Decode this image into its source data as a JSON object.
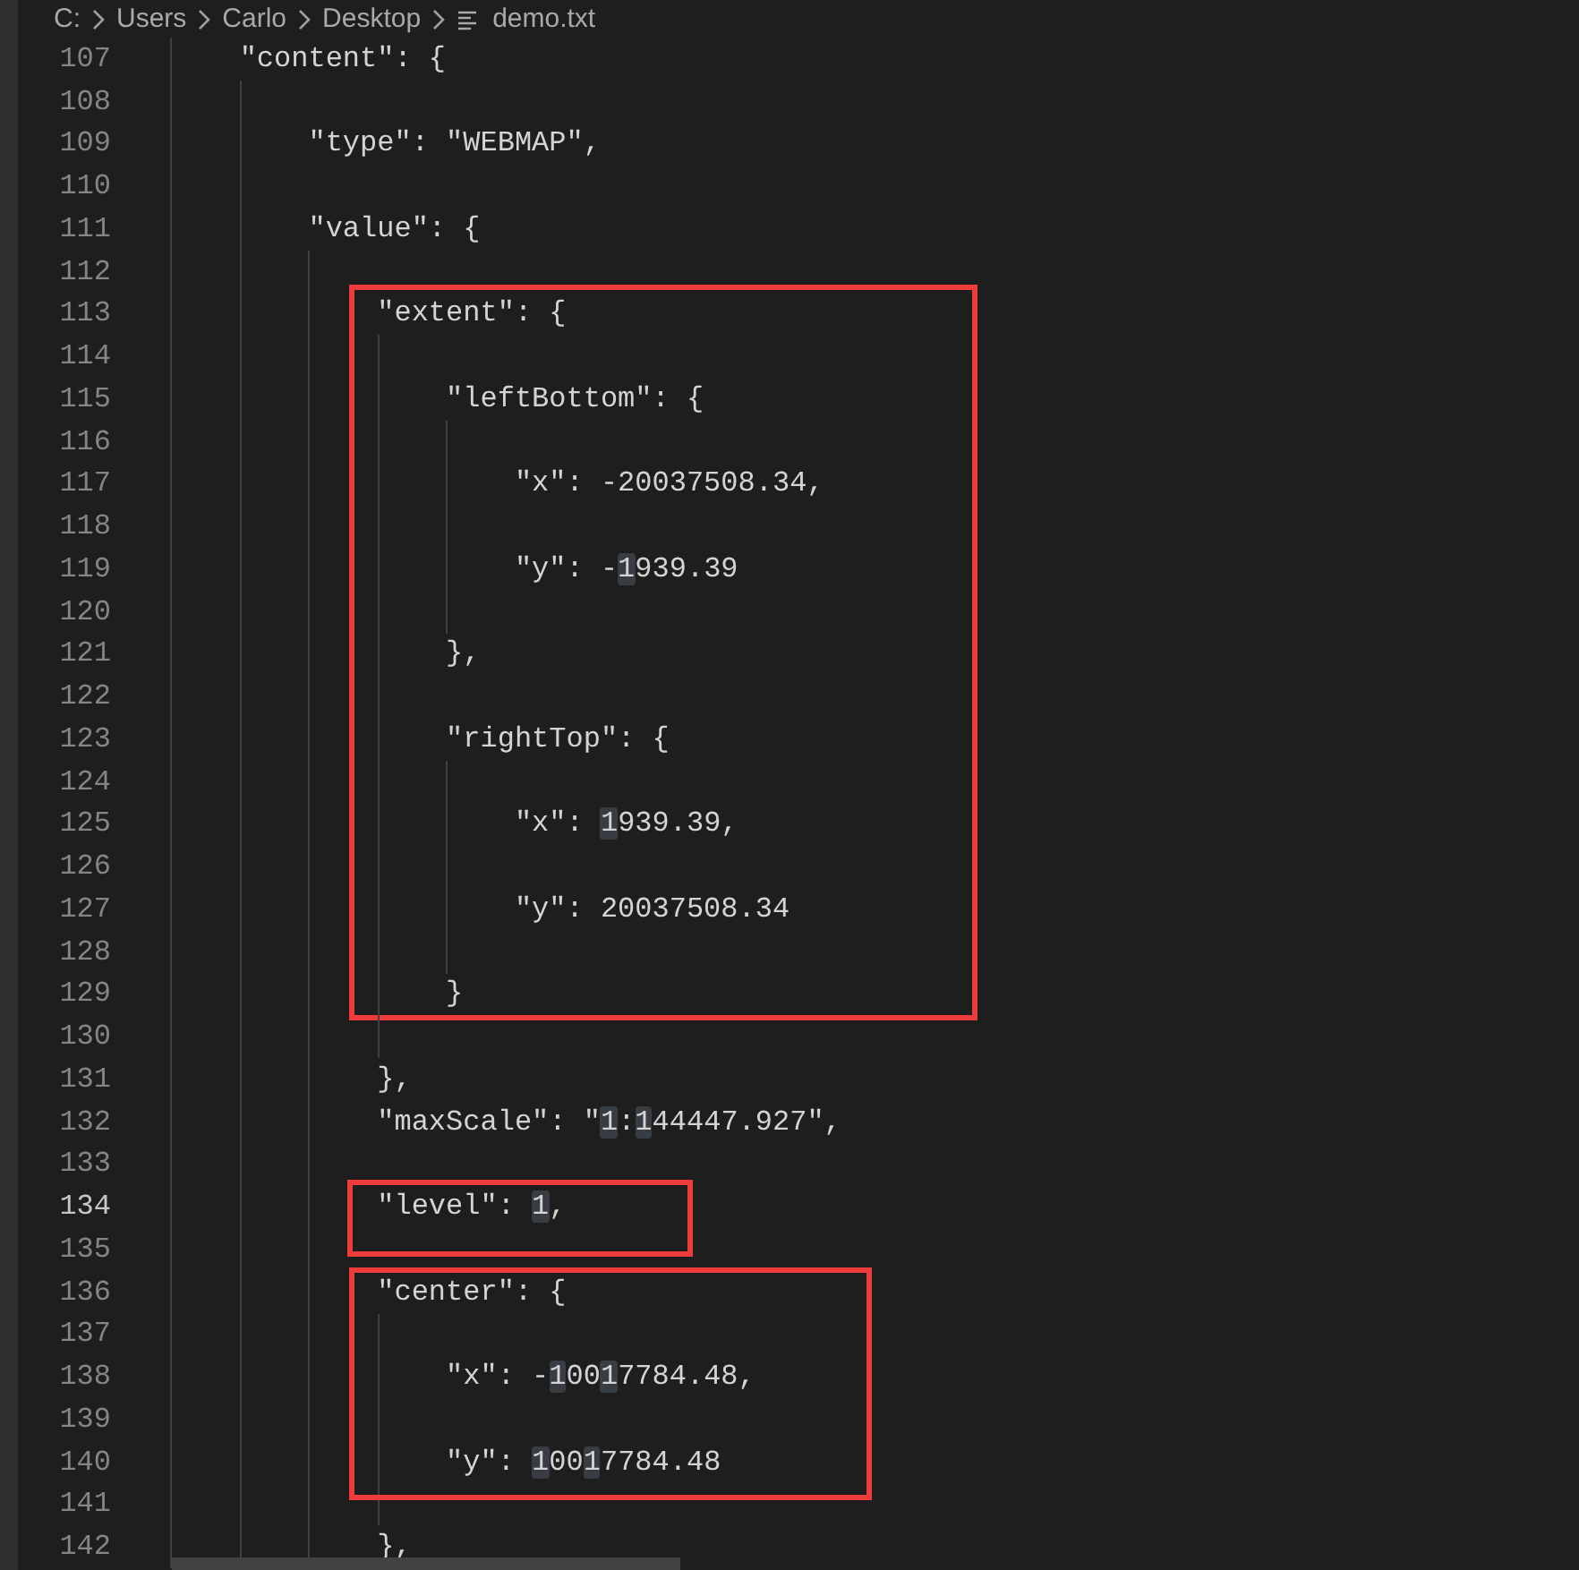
{
  "breadcrumb": [
    {
      "label": "C:",
      "kind": "folder"
    },
    {
      "label": "Users",
      "kind": "folder"
    },
    {
      "label": "Carlo",
      "kind": "folder"
    },
    {
      "label": "Desktop",
      "kind": "folder"
    },
    {
      "label": "demo.txt",
      "kind": "file"
    }
  ],
  "editor": {
    "items": [
      {
        "kind": "line",
        "number": "107",
        "current": false,
        "parts": [
          {
            "text": "        \"content\": {",
            "highlight": false
          }
        ]
      },
      {
        "kind": "line",
        "number": "108",
        "current": false
      },
      {
        "kind": "line",
        "number": "109",
        "current": false,
        "parts": [
          {
            "text": "            \"type\": \"WEBMAP\",",
            "highlight": false
          }
        ]
      },
      {
        "kind": "line",
        "number": "110",
        "current": false
      },
      {
        "kind": "line",
        "number": "111",
        "current": false,
        "parts": [
          {
            "text": "            \"value\": {",
            "highlight": false
          }
        ]
      },
      {
        "kind": "line",
        "number": "112",
        "current": false
      },
      {
        "kind": "box",
        "lines": [
          {
            "kind": "line",
            "number": "113",
            "current": false,
            "parts": [
              {
                "text": "                \"extent\": {",
                "highlight": false
              }
            ]
          },
          {
            "kind": "line",
            "number": "114",
            "current": false
          },
          {
            "kind": "line",
            "number": "115",
            "current": false,
            "parts": [
              {
                "text": "                    \"leftBottom\": {",
                "highlight": false
              }
            ]
          },
          {
            "kind": "line",
            "number": "116",
            "current": false
          },
          {
            "kind": "line",
            "number": "117",
            "current": false,
            "parts": [
              {
                "text": "                        \"x\": -20037508.34,",
                "highlight": false
              }
            ]
          },
          {
            "kind": "line",
            "number": "118",
            "current": false
          },
          {
            "kind": "line",
            "number": "119",
            "current": false,
            "parts": [
              {
                "text": "                        \"y\": -",
                "highlight": false
              },
              {
                "text": "1",
                "highlight": true
              },
              {
                "text": "939.39",
                "highlight": false
              }
            ]
          },
          {
            "kind": "line",
            "number": "120",
            "current": false
          },
          {
            "kind": "line",
            "number": "121",
            "current": false,
            "parts": [
              {
                "text": "                    },",
                "highlight": false
              }
            ]
          },
          {
            "kind": "line",
            "number": "122",
            "current": false
          },
          {
            "kind": "line",
            "number": "123",
            "current": false,
            "parts": [
              {
                "text": "                    \"rightTop\": {",
                "highlight": false
              }
            ]
          },
          {
            "kind": "line",
            "number": "124",
            "current": false
          },
          {
            "kind": "line",
            "number": "125",
            "current": false,
            "parts": [
              {
                "text": "                        \"x\": ",
                "highlight": false
              },
              {
                "text": "1",
                "highlight": true
              },
              {
                "text": "939.39,",
                "highlight": false
              }
            ]
          },
          {
            "kind": "line",
            "number": "126",
            "current": false
          },
          {
            "kind": "line",
            "number": "127",
            "current": false,
            "parts": [
              {
                "text": "                        \"y\": 20037508.34",
                "highlight": false
              }
            ]
          },
          {
            "kind": "line",
            "number": "128",
            "current": false
          },
          {
            "kind": "line",
            "number": "129",
            "current": false,
            "parts": [
              {
                "text": "                    }",
                "highlight": false
              }
            ]
          }
        ]
      },
      {
        "kind": "line",
        "number": "130",
        "current": false
      },
      {
        "kind": "line",
        "number": "131",
        "current": false,
        "parts": [
          {
            "text": "                },",
            "highlight": false
          }
        ]
      },
      {
        "kind": "line",
        "number": "132",
        "current": false,
        "parts": [
          {
            "text": "                \"maxScale\": \"",
            "highlight": false
          },
          {
            "text": "1",
            "highlight": true
          },
          {
            "text": ":",
            "highlight": false
          },
          {
            "text": "1",
            "highlight": true
          },
          {
            "text": "44447.927\",",
            "highlight": false
          }
        ]
      },
      {
        "kind": "line",
        "number": "133",
        "current": false
      },
      {
        "kind": "box",
        "lines": [
          {
            "kind": "line",
            "number": "134",
            "current": true,
            "parts": [
              {
                "text": "                \"level\": ",
                "highlight": false
              },
              {
                "text": "1",
                "highlight": true
              },
              {
                "text": ",",
                "highlight": false
              }
            ]
          },
          {
            "kind": "line",
            "number": "135",
            "current": false
          }
        ]
      },
      {
        "kind": "box",
        "lines": [
          {
            "kind": "line",
            "number": "136",
            "current": false,
            "parts": [
              {
                "text": "                \"center\": {",
                "highlight": false
              }
            ]
          },
          {
            "kind": "line",
            "number": "137",
            "current": false
          },
          {
            "kind": "line",
            "number": "138",
            "current": false,
            "parts": [
              {
                "text": "                    \"x\": -",
                "highlight": false
              },
              {
                "text": "1",
                "highlight": true
              },
              {
                "text": "00",
                "highlight": false
              },
              {
                "text": "1",
                "highlight": true
              },
              {
                "text": "7784.48,",
                "highlight": false
              }
            ]
          },
          {
            "kind": "line",
            "number": "139",
            "current": false
          },
          {
            "kind": "line",
            "number": "140",
            "current": false,
            "parts": [
              {
                "text": "                    \"y\": ",
                "highlight": false
              },
              {
                "text": "1",
                "highlight": true
              },
              {
                "text": "00",
                "highlight": false
              },
              {
                "text": "1",
                "highlight": true
              },
              {
                "text": "7784.48",
                "highlight": false
              }
            ]
          },
          {
            "kind": "line",
            "number": "141",
            "current": false
          }
        ]
      },
      {
        "kind": "line",
        "number": "142",
        "current": false,
        "parts": [
          {
            "text": "                },",
            "highlight": false
          }
        ]
      }
    ]
  }
}
